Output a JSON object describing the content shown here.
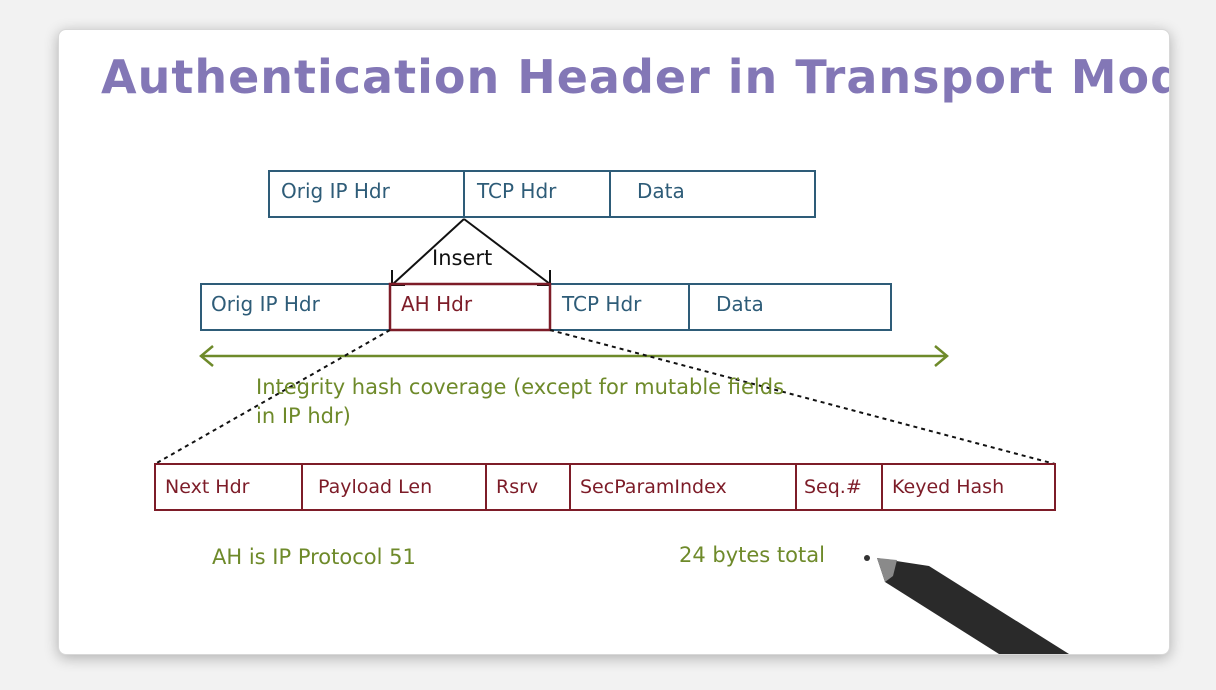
{
  "title": "Authentication Header in Transport Mode",
  "original_packet": {
    "fields": [
      "Orig IP Hdr",
      "TCP Hdr",
      "Data"
    ]
  },
  "insert_label": "Insert",
  "ah_packet": {
    "fields": [
      "Orig IP Hdr",
      "AH Hdr",
      "TCP Hdr",
      "Data"
    ]
  },
  "coverage": {
    "line1": "Integrity hash coverage (except for mutable fields",
    "line2": "in IP hdr)"
  },
  "ah_header": {
    "fields": [
      "Next Hdr",
      "Payload Len",
      "Rsrv",
      "SecParamIndex",
      "Seq.#",
      "Keyed Hash"
    ]
  },
  "notes": {
    "protocol": "AH is IP Protocol 51",
    "size": "24 bytes total"
  },
  "colors": {
    "title": "#8377b6",
    "packet_blue": "#2e5c78",
    "ah_red": "#7d1c28",
    "annotation_green": "#6e8a2a"
  }
}
